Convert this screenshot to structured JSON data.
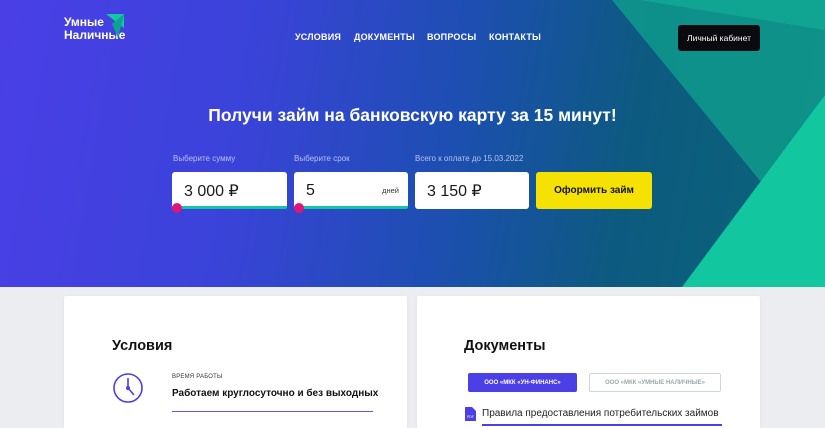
{
  "header": {
    "logo_line1": "Умные",
    "logo_line2": "Наличные",
    "nav": [
      "Условия",
      "Документы",
      "Вопросы",
      "Контакты"
    ],
    "cabinet_label": "Личный кабинет"
  },
  "hero": {
    "title": "Получи займ на банковскую карту за 15 минут!",
    "amount": {
      "label": "Выберите сумму",
      "value": "3 000 ₽",
      "slider_fraction": 0.0
    },
    "term": {
      "label": "Выберите срок",
      "value": "5",
      "unit": "дней",
      "slider_fraction": 0.0
    },
    "total": {
      "label": "Всего к оплате до 15.03.2022",
      "value": "3 150 ₽"
    },
    "submit_label": "Оформить займ"
  },
  "conditions": {
    "title": "Условия",
    "work_label": "Время работы",
    "work_value": "Работаем круглосуточно и без выходных"
  },
  "documents": {
    "title": "Документы",
    "org_tabs": [
      "ООО «МКК «УН-ФИНАНС»",
      "ООО «МКК «УМНЫЕ НАЛИЧНЫЕ»"
    ],
    "doc_icon_label": "PDF",
    "doc_link": "Правила предоставления потребительских займов"
  },
  "colors": {
    "accent": "#4b3fe6",
    "button_yellow": "#f5e203",
    "slider_green": "#12c6a8",
    "slider_knob": "#e0157a",
    "deco_green": "#12c6a0"
  }
}
